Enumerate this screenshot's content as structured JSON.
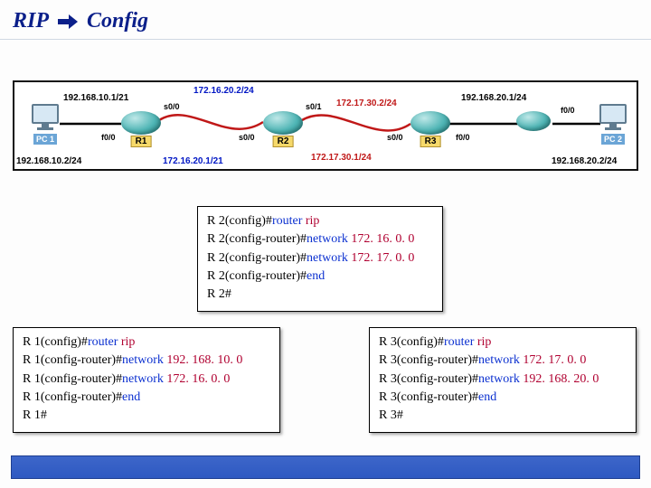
{
  "title": {
    "word1": "RIP",
    "word2": "Config"
  },
  "pcs": {
    "pc1": "PC 1",
    "pc2": "PC 2"
  },
  "routers": {
    "r1": "R1",
    "r2": "R2",
    "r3": "R3"
  },
  "ports": {
    "r1_f00": "f0/0",
    "r1_s00": "s0/0",
    "r2_s00_l": "s0/0",
    "r2_s01": "s0/1",
    "r3_s00": "s0/0",
    "r3_f00": "f0/0",
    "pc2_f00": "f0/0"
  },
  "ips": {
    "pc1_lan": "192.168.10.1/21",
    "pc1_host": "192.168.10.2/24",
    "r1_r2_top": "172.16.20.2/24",
    "r1_r2_bot": "172.16.20.1/21",
    "r2_r3_top": "172.17.30.2/24",
    "r2_r3_bot": "172.17.30.1/24",
    "r3_lan": "192.168.20.1/24",
    "pc2_host": "192.168.20.2/24"
  },
  "cfg_r2": {
    "l1p": "R 2(config)#",
    "l1c": "router",
    "l1a": "rip",
    "l2p": "R 2(config-router)#",
    "l2c": "network",
    "l2a": "172. 16. 0. 0",
    "l3p": "R 2(config-router)#",
    "l3c": "network",
    "l3a": "172. 17. 0. 0",
    "l4p": "R 2(config-router)#",
    "l4c": "end",
    "l5": "R 2#"
  },
  "cfg_r1": {
    "l1p": "R 1(config)#",
    "l1c": "router",
    "l1a": "rip",
    "l2p": "R 1(config-router)#",
    "l2c": "network",
    "l2a": "192. 168. 10. 0",
    "l3p": "R 1(config-router)#",
    "l3c": "network",
    "l3a": "172. 16. 0. 0",
    "l4p": "R 1(config-router)#",
    "l4c": "end",
    "l5": "R 1#"
  },
  "cfg_r3": {
    "l1p": "R 3(config)#",
    "l1c": "router",
    "l1a": "rip",
    "l2p": "R 3(config-router)#",
    "l2c": "network",
    "l2a": "172. 17. 0. 0",
    "l3p": "R 3(config-router)#",
    "l3c": "network",
    "l3a": "192. 168. 20. 0",
    "l4p": "R 3(config-router)#",
    "l4c": "end",
    "l5": "R 3#"
  }
}
